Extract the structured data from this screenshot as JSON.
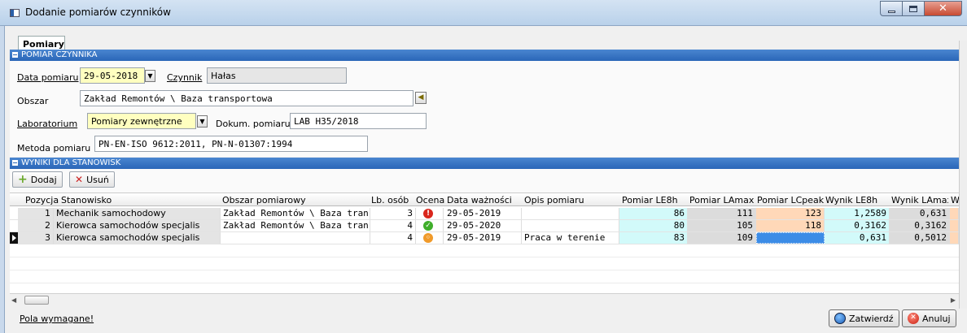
{
  "window": {
    "title": "Dodanie pomiarów czynników"
  },
  "tab": {
    "label": "Pomiary"
  },
  "section1": {
    "title": "POMIAR CZYNNIKA",
    "data_pomiaru_label": "Data pomiaru",
    "data_pomiaru_value": "29-05-2018",
    "czynnik_label": "Czynnik",
    "czynnik_value": "Hałas",
    "obszar_label": "Obszar",
    "obszar_value": "Zakład Remontów \\ Baza transportowa",
    "laboratorium_label": "Laboratorium",
    "laboratorium_value": "Pomiary zewnętrzne",
    "dokum_label": "Dokum. pomiaru",
    "dokum_value": "LAB H35/2018",
    "metoda_label": "Metoda pomiaru",
    "metoda_value": "PN-EN-ISO 9612:2011, PN-N-01307:1994"
  },
  "section2": {
    "title": "WYNIKI DLA STANOWISK",
    "add_label": "Dodaj",
    "delete_label": "Usuń"
  },
  "grid": {
    "headers": [
      "Pozycja",
      "Stanowisko",
      "Obszar pomiarowy",
      "Lb. osób",
      "Ocena",
      "Data ważności",
      "Opis pomiaru",
      "Pomiar LE8h",
      "Pomiar LAmax",
      "Pomiar LCpeak",
      "Wynik LE8h",
      "Wynik LAmax",
      "W"
    ],
    "rows": [
      {
        "pozycja": "1",
        "stanowisko": "Mechanik samochodowy",
        "obszar": "Zakład Remontów \\ Baza tran",
        "osob": "3",
        "ocena": "!",
        "data": "29-05-2019",
        "opis": "",
        "le8h": "86",
        "lamax": "111",
        "lcpeak": "123",
        "w_le8h": "1,2589",
        "w_lamax": "0,631"
      },
      {
        "pozycja": "2",
        "stanowisko": "Kierowca samochodów specjalis",
        "obszar": "Zakład Remontów \\ Baza tran",
        "osob": "4",
        "ocena": "✓",
        "data": "29-05-2020",
        "opis": "",
        "le8h": "80",
        "lamax": "105",
        "lcpeak": "118",
        "w_le8h": "0,3162",
        "w_lamax": "0,3162"
      },
      {
        "pozycja": "3",
        "stanowisko": "Kierowca samochodów specjalis",
        "obszar": "",
        "osob": "4",
        "ocena": "◦",
        "data": "29-05-2019",
        "opis": "Praca w terenie",
        "le8h": "83",
        "lamax": "109",
        "lcpeak": "",
        "w_le8h": "0,631",
        "w_lamax": "0,5012"
      }
    ]
  },
  "footer": {
    "required_link": "Pola wymagane!",
    "ok_label": "Zatwierdź",
    "cancel_label": "Anuluj"
  },
  "colors": {
    "section_header": "#2a66b8",
    "cyan_cell": "#d2fafa",
    "orange_cell": "#ffd8b8",
    "gray_cell": "#dcdcdc",
    "selected_cell": "#3c8ce6"
  }
}
